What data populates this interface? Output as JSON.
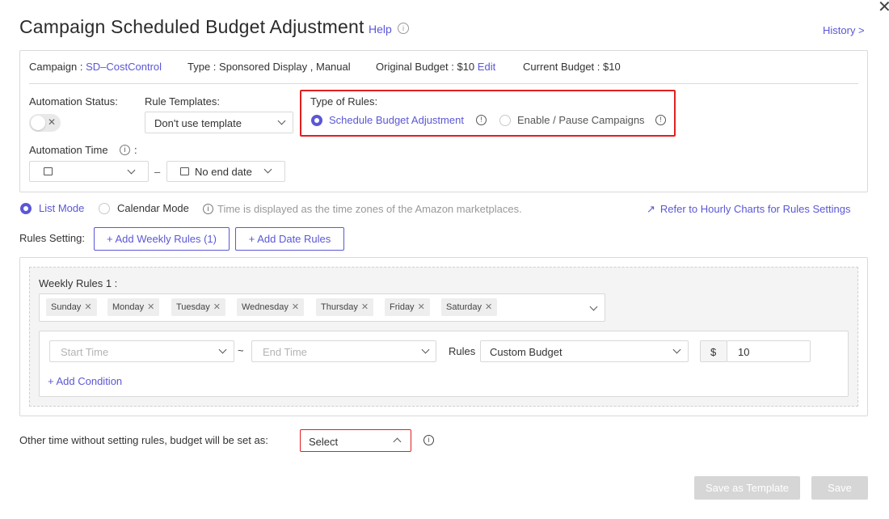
{
  "header": {
    "title": "Campaign Scheduled Budget Adjustment",
    "help_label": "Help",
    "history_label": "History >",
    "close_glyph": "✕"
  },
  "campaign_info": {
    "campaign_label": "Campaign :",
    "campaign_value": "SD–CostControl",
    "type_label": "Type :",
    "type_value": "Sponsored Display , Manual",
    "original_budget_label": "Original Budget :",
    "original_budget_value": "$10",
    "edit_label": "Edit",
    "current_budget_label": "Current Budget :",
    "current_budget_value": "$10"
  },
  "automation": {
    "status_label": "Automation Status:",
    "toggle_off_glyph": "✕",
    "templates_label": "Rule Templates:",
    "template_value": "Don't use template",
    "time_label": "Automation Time",
    "time_colon": ":",
    "range_dash": "–",
    "end_date_value": "No end date"
  },
  "type_of_rules": {
    "label": "Type of Rules:",
    "options": [
      {
        "label": "Schedule Budget Adjustment",
        "selected": true
      },
      {
        "label": "Enable / Pause Campaigns",
        "selected": false
      }
    ]
  },
  "mode": {
    "list_mode": "List Mode",
    "calendar_mode": "Calendar Mode",
    "timezone_note": "Time is displayed as the time zones of the Amazon marketplaces.",
    "hourly_charts_link": "Refer to Hourly Charts for Rules Settings"
  },
  "rules_setting": {
    "label": "Rules Setting:",
    "add_weekly": "+ Add Weekly Rules (1)",
    "add_date": "+ Add Date Rules"
  },
  "weekly_rule": {
    "title": "Weekly Rules 1 :",
    "days": [
      "Sunday",
      "Monday",
      "Tuesday",
      "Wednesday",
      "Thursday",
      "Friday",
      "Saturday"
    ],
    "start_placeholder": "Start Time",
    "tilde": "~",
    "end_placeholder": "End Time",
    "rules_label": "Rules",
    "rule_value": "Custom Budget",
    "currency": "$",
    "amount": "10",
    "add_condition": "+ Add Condition"
  },
  "footer": {
    "other_time_label": "Other time without setting rules, budget will be set as:",
    "select_value": "Select",
    "save_template": "Save as Template",
    "save": "Save"
  },
  "colors": {
    "accent": "#5b57d6",
    "highlight_border": "#e02020",
    "disabled": "#d6d6d6"
  }
}
